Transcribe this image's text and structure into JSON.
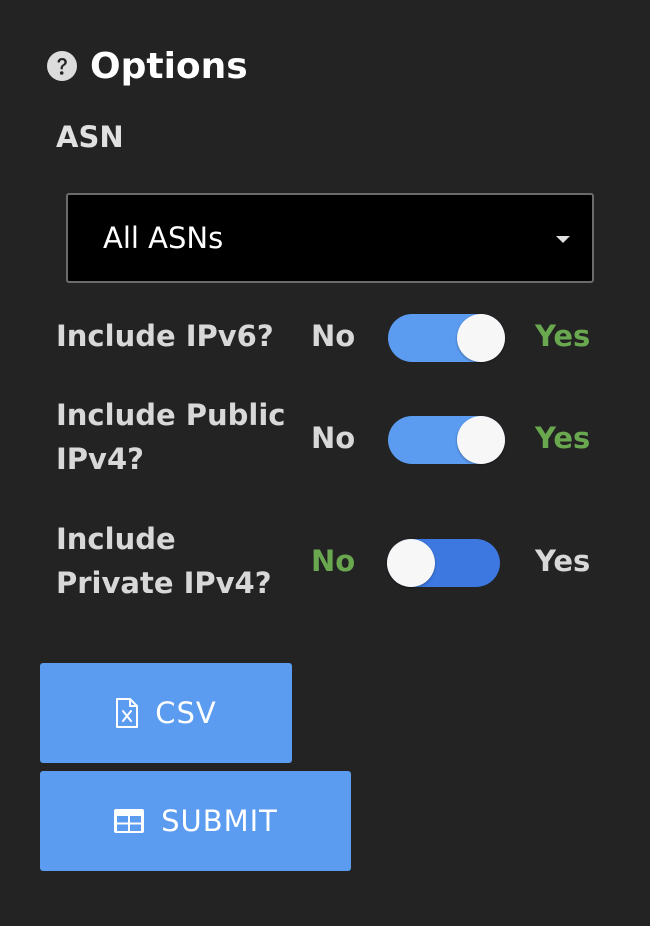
{
  "header": {
    "icon": "help-circle-icon",
    "title": "Options"
  },
  "asn": {
    "label": "ASN",
    "selected": "All ASNs",
    "dropdown_icon": "caret-down-icon"
  },
  "toggles": [
    {
      "label": "Include IPv6?",
      "off_label": "No",
      "on_label": "Yes",
      "state": "on"
    },
    {
      "label": "Include Public IPv4?",
      "off_label": "No",
      "on_label": "Yes",
      "state": "on"
    },
    {
      "label": "Include Private IPv4?",
      "off_label": "No",
      "on_label": "Yes",
      "state": "off"
    }
  ],
  "buttons": {
    "csv": {
      "label": "CSV",
      "icon": "file-excel-icon"
    },
    "submit": {
      "label": "SUBMIT",
      "icon": "table-icon"
    }
  },
  "colors": {
    "background": "#232323",
    "accent_blue": "#5b9bf0",
    "toggle_off_track": "#3d78e0",
    "active_label_green": "#6aa84f",
    "select_background": "#000000"
  }
}
